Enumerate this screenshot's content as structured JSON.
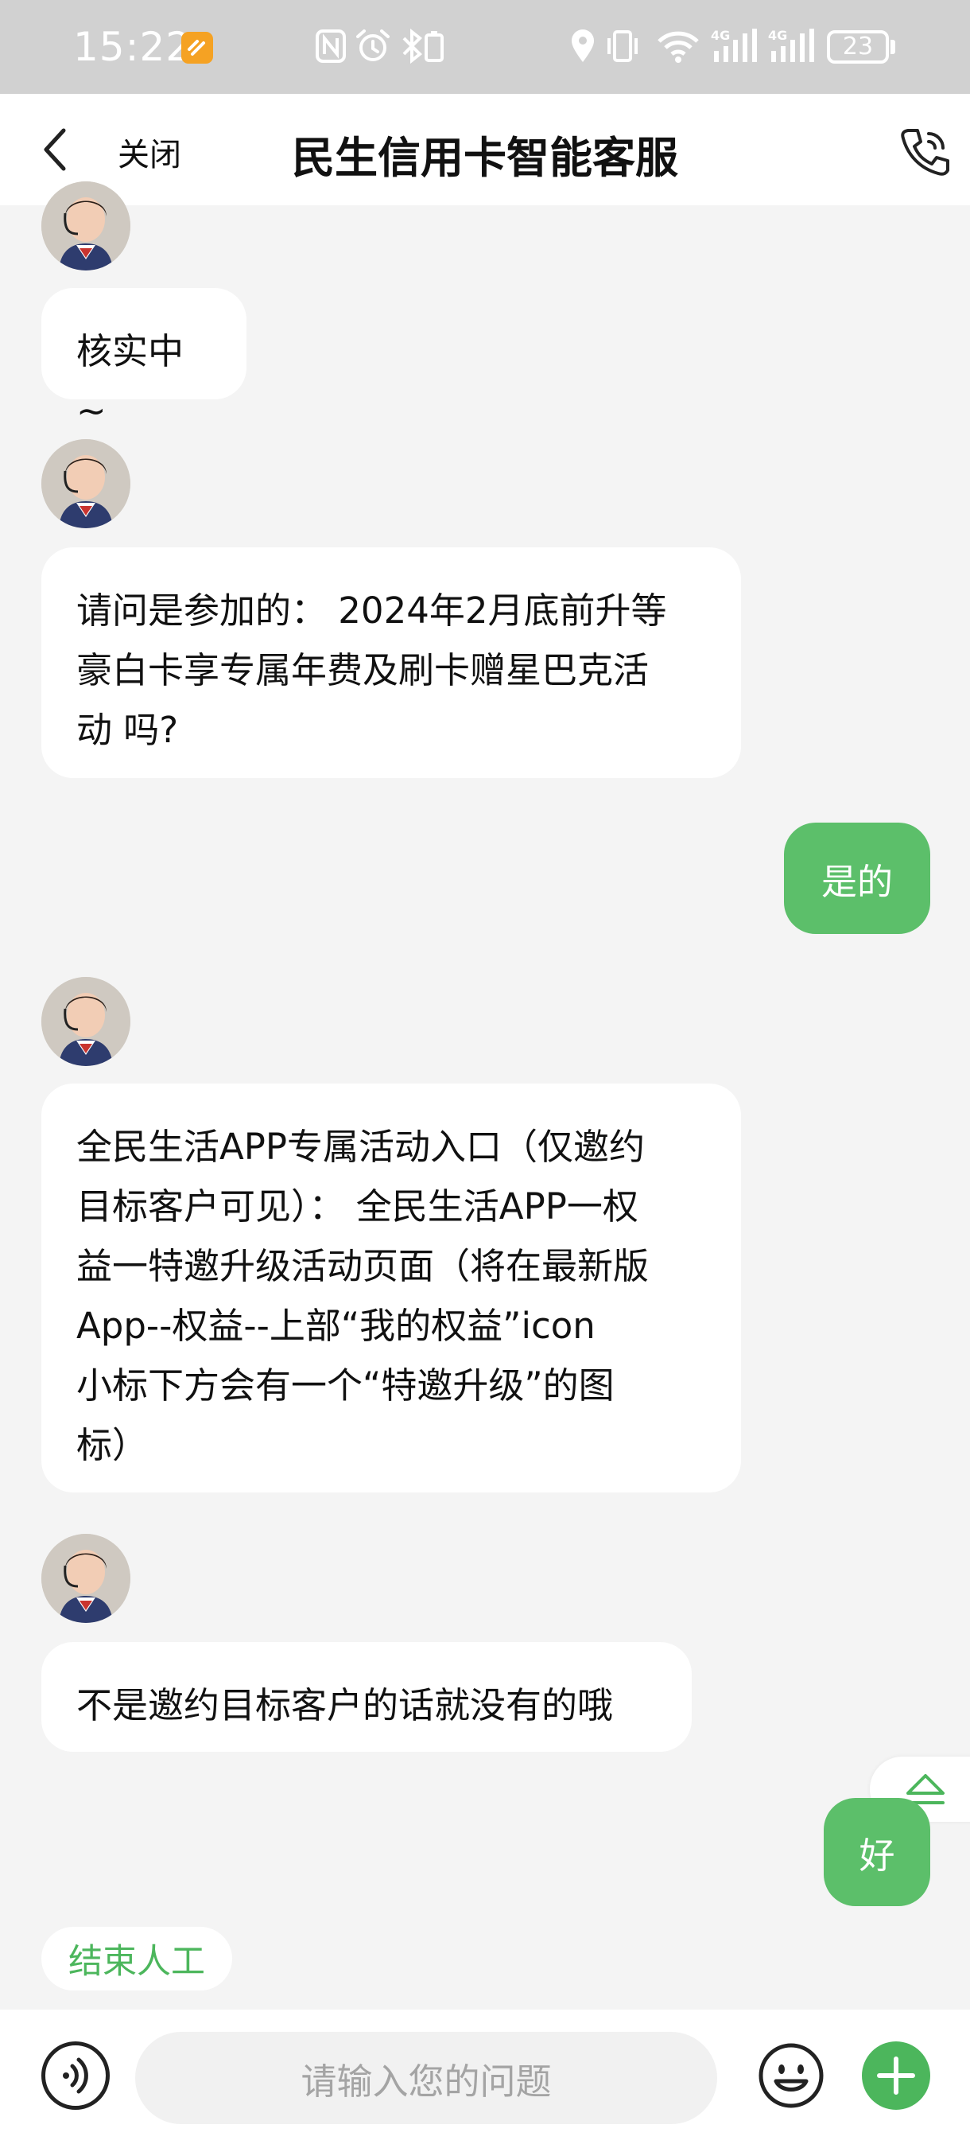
{
  "status_bar": {
    "time": "15:22",
    "battery": "23",
    "icons": [
      "nfc-icon",
      "alarm-icon",
      "bluetooth-icon",
      "location-icon",
      "vibrate-icon",
      "wifi-icon",
      "signal-4g-icon",
      "signal-4g-icon"
    ]
  },
  "nav": {
    "back_icon": "chevron-left-icon",
    "close_label": "关闭",
    "title": "民生信用卡智能客服",
    "phone_icon": "phone-icon"
  },
  "messages": [
    {
      "side": "left",
      "text": "核实中~"
    },
    {
      "side": "left",
      "lines": [
        "请问是参加的：  2024年2月底前升等",
        "豪白卡享专属年费及刷卡赠星巴克活",
        "动 吗?"
      ]
    },
    {
      "side": "right",
      "text": "是的"
    },
    {
      "side": "left",
      "lines": [
        "全民生活APP专属活动入口（仅邀约",
        "目标客户可见）：  全民生活APP一权",
        "益一特邀升级活动页面（将在最新版",
        "App--权益--上部“我的权益”icon",
        "小标下方会有一个“特邀升级”的图",
        "标）"
      ]
    },
    {
      "side": "left",
      "text": "不是邀约目标客户的话就没有的哦"
    },
    {
      "side": "right",
      "text": "好"
    }
  ],
  "end_chat_label": "结束人工",
  "input": {
    "placeholder": "请输入您的问题"
  },
  "colors": {
    "accent": "#5cbf6a",
    "status_bar": "#d1d1d1",
    "background": "#f4f4f4"
  }
}
